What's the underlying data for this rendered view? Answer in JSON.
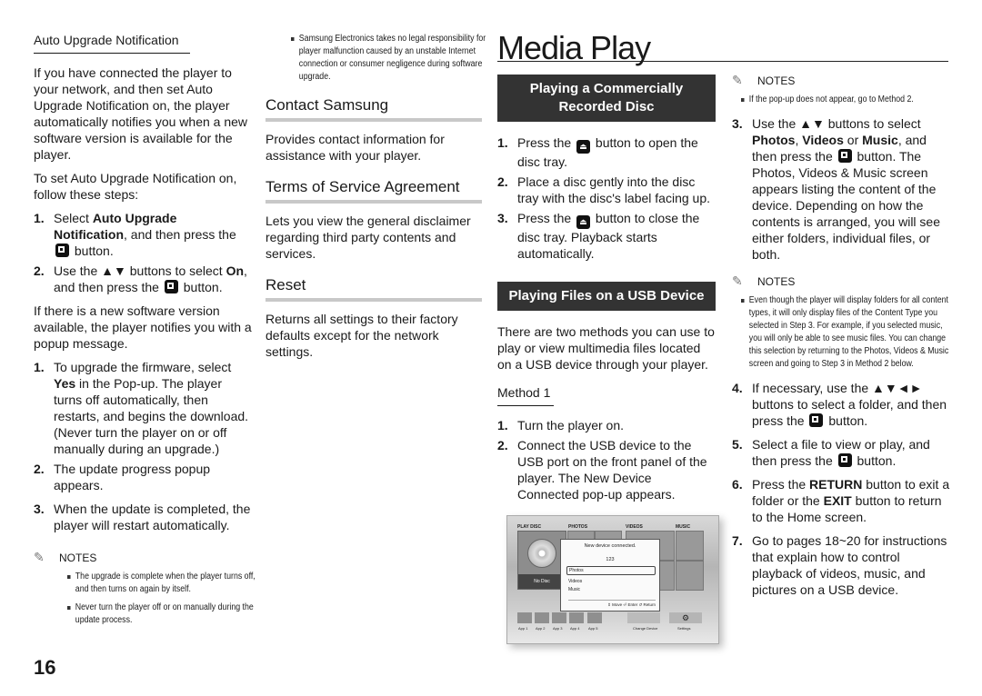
{
  "page_number": "16",
  "col1": {
    "heading": "Auto Upgrade Notification",
    "intro": "If you have connected the player to your network, and then set Auto Upgrade Notification on, the player automatically notifies you when a new software version is available for the player.",
    "instructions": "To set Auto Upgrade Notification on, follow these steps:",
    "steps_a": [
      {
        "num": "1.",
        "pre": "Select ",
        "bold": "Auto Upgrade Notification",
        "post": ", and then press the",
        "post2": "button."
      },
      {
        "num": "2.",
        "pre": "Use the ▲▼ buttons to select ",
        "bold": "On",
        "post": ", and then press the",
        "post2": "button."
      }
    ],
    "popup_text": "If there is a new software version available, the player notifies you with a popup message.",
    "steps_b": [
      {
        "num": "1.",
        "pre": "To upgrade the firmware, select ",
        "bold": "Yes",
        "post": " in the Pop-up. The player turns off automatically, then restarts, and begins the download. (Never turn the player on or off manually during an upgrade.)"
      },
      {
        "num": "2.",
        "text": "The update progress popup appears."
      },
      {
        "num": "3.",
        "text": "When the update is completed, the player will restart automatically."
      }
    ],
    "notes_label": "NOTES",
    "notes": [
      "The upgrade is complete when the player turns off, and then turns on again by itself.",
      "Never turn the player off or on manually during the update process."
    ]
  },
  "col2": {
    "top_note": "Samsung Electronics takes no legal responsibility for player malfunction caused by an unstable Internet connection or consumer negligence during software upgrade.",
    "sections": [
      {
        "title": "Contact Samsung",
        "text": "Provides contact information for assistance with your player."
      },
      {
        "title": "Terms of Service Agreement",
        "text": "Lets you view the general disclaimer regarding third party contents and services."
      },
      {
        "title": "Reset",
        "text": "Returns all settings to their factory defaults except for the network settings."
      }
    ]
  },
  "col3": {
    "page_title": "Media Play",
    "box1": "Playing a Commercially Recorded Disc",
    "disc_steps": [
      {
        "num": "1.",
        "pre": "Press the",
        "post": "button to open the disc tray."
      },
      {
        "num": "2.",
        "text": "Place a disc gently into the disc tray with the disc's label facing up."
      },
      {
        "num": "3.",
        "pre": "Press the",
        "post": "button to close the disc tray. Playback starts automatically."
      }
    ],
    "box2": "Playing Files on a USB Device",
    "usb_intro": "There are two methods you can use to play or view multimedia files located on a USB device through your player.",
    "method_heading": "Method 1",
    "method_steps": [
      {
        "num": "1.",
        "text": "Turn the player on."
      },
      {
        "num": "2.",
        "text": "Connect the USB device to the USB port on the front panel of the player. The New Device Connected pop-up appears."
      }
    ],
    "figure": {
      "labels": [
        "PLAY DISC",
        "PHOTOS",
        "VIDEOS",
        "MUSIC"
      ],
      "no_disc": "No Disc",
      "popup_title": "New device connected.",
      "popup_device": "123",
      "popup_options": [
        "Photos",
        "Videos",
        "Music"
      ],
      "popup_footer": "⇕ Move  ⏎ Enter  ↺ Return",
      "apps": [
        "App 1",
        "App 2",
        "App 3",
        "App 4",
        "App 5"
      ],
      "change_device": "Change Device",
      "settings": "Settings"
    }
  },
  "col4": {
    "notes1_label": "NOTES",
    "notes1": [
      "If the pop-up does not appear, go to Method 2."
    ],
    "step3": {
      "num": "3.",
      "pre": "Use the ▲▼ buttons to select ",
      "b1": "Photos",
      "m1": ", ",
      "b2": "Videos",
      "m2": " or ",
      "b3": "Music",
      "m3": ", and then press the",
      "post": "button. The Photos, Videos & Music screen appears listing the content of the device. Depending on how the contents is arranged, you will see either folders, individual files, or both."
    },
    "notes2_label": "NOTES",
    "notes2": [
      "Even though the player will display folders for all content types, it will only display files of the Content Type you selected in Step 3. For example, if you selected music, you will only be able to see music files. You can change this selection by returning to the Photos, Videos & Music screen and going to Step 3 in Method 2 below."
    ],
    "steps": [
      {
        "num": "4.",
        "pre": "If necessary, use the ▲▼◄► buttons to select a folder, and then press the",
        "post": "button."
      },
      {
        "num": "5.",
        "pre": "Select a file to view or play, and then press the",
        "post": "button."
      },
      {
        "num": "6.",
        "pre": "Press the ",
        "b1": "RETURN",
        "m1": " button to exit a folder or the ",
        "b2": "EXIT",
        "post": " button to return to the Home screen."
      },
      {
        "num": "7.",
        "text": "Go to pages 18~20 for instructions that explain how to control playback of videos, music, and pictures on a USB device."
      }
    ]
  }
}
